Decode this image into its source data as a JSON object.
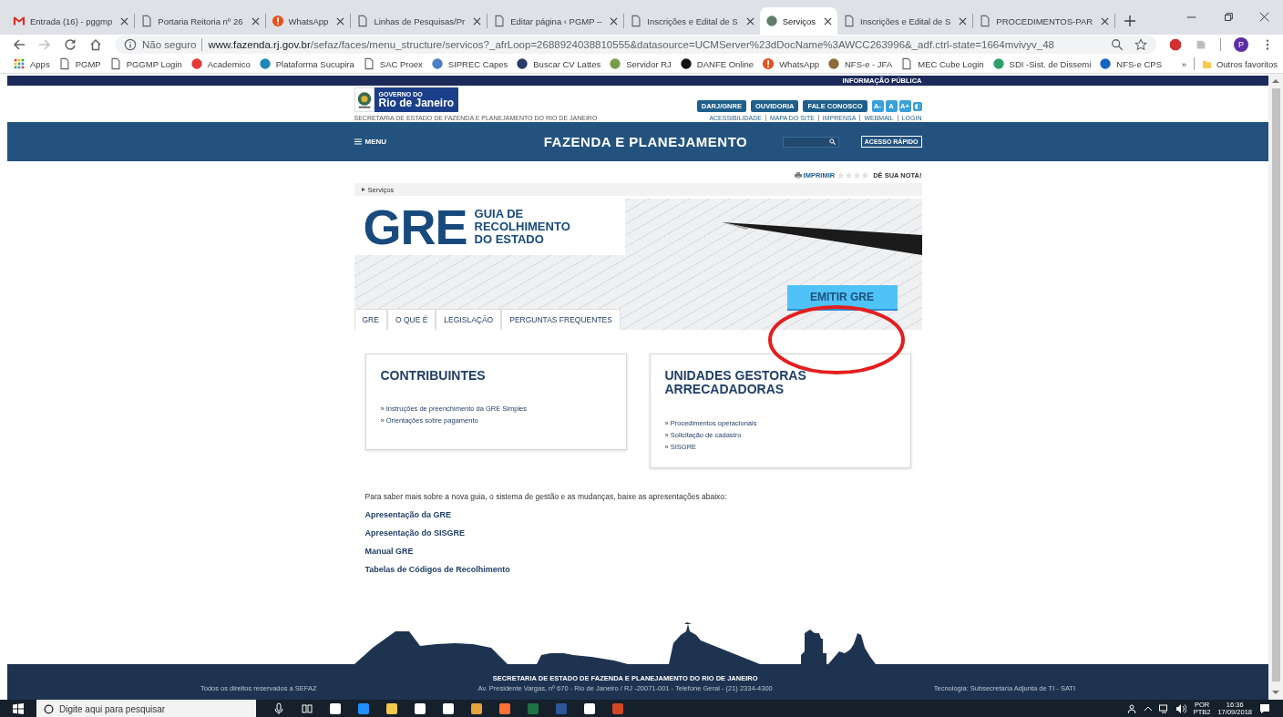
{
  "browser_tabs": [
    {
      "kind": "gmail",
      "title": "Entrada (16) - pggmp",
      "selected": false
    },
    {
      "kind": "page",
      "title": "Portaria Reitoria nº 26",
      "selected": false
    },
    {
      "kind": "alert",
      "title": "WhatsApp",
      "selected": false
    },
    {
      "kind": "page",
      "title": "Linhas de Pesquisas/Pr",
      "selected": false
    },
    {
      "kind": "page",
      "title": "Editar página ‹ PGMP –",
      "selected": false
    },
    {
      "kind": "page",
      "title": "Inscrições e Edital de S",
      "selected": false
    },
    {
      "kind": "logo",
      "color": "#5f7f6a",
      "title": "Serviços",
      "selected": true
    },
    {
      "kind": "page",
      "title": "Inscrições e Edital de S",
      "selected": false
    },
    {
      "kind": "page",
      "title": "PROCEDIMENTOS-PAR",
      "selected": false
    }
  ],
  "address_bar": {
    "security": "Não seguro",
    "host": "www.fazenda.rj.gov.br",
    "path": "/sefaz/faces/menu_structure/servicos?_afrLoop=2688924038810555&datasource=UCMServer%23dDocName%3AWCC263996&_adf.ctrl-state=1664mvivyv_48",
    "profile_initial": "P"
  },
  "bookmarks": [
    {
      "kind": "grid",
      "label": "Apps"
    },
    {
      "kind": "page",
      "label": "PGMP"
    },
    {
      "kind": "page",
      "label": "PGGMP Login"
    },
    {
      "kind": "logo",
      "color": "#e53935",
      "label": "Academico"
    },
    {
      "kind": "logo",
      "color": "#1e88b4",
      "label": "Plataforma Sucupira"
    },
    {
      "kind": "page",
      "label": "SAC Proex"
    },
    {
      "kind": "logo",
      "color": "#4a7fc1",
      "label": "SIPREC Capes"
    },
    {
      "kind": "logo",
      "color": "#2b3a67",
      "label": "Buscar CV Lattes"
    },
    {
      "kind": "logo",
      "color": "#7a9a4a",
      "label": "Servidor RJ"
    },
    {
      "kind": "logo",
      "color": "#111111",
      "label": "DANFE Online"
    },
    {
      "kind": "alert",
      "label": "WhatsApp"
    },
    {
      "kind": "logo",
      "color": "#8a6d3b",
      "label": "NFS-e - JFA"
    },
    {
      "kind": "page",
      "label": "MEC Cube Login"
    },
    {
      "kind": "logo",
      "color": "#2e9e6a",
      "label": "SDI -Sist. de Dissemi"
    },
    {
      "kind": "logo",
      "color": "#1565c0",
      "label": "NFS-e CPS"
    }
  ],
  "bookmarks_overflow": "»",
  "other_bookmarks": "Outros favoritos",
  "site": {
    "top_strip": "INFORMAÇÃO PÚBLICA",
    "logo_small": "GOVERNO DO",
    "logo_big": "Rio de Janeiro",
    "secretariat": "SECRETARIA DE ESTADO DE FAZENDA E PLANEJAMENTO DO RIO DE JANEIRO",
    "header_buttons": [
      "DARJ/GNRE",
      "OUVIDORIA",
      "FALE CONOSCO"
    ],
    "font_buttons": [
      "A-",
      "A",
      "A+"
    ],
    "utility_links": [
      "ACESSIBILIDADE",
      "MAPA DO SITE",
      "IMPRENSA",
      "WEBMAIL",
      "LOGIN"
    ],
    "menu": "MENU",
    "title": "FAZENDA E PLANEJAMENTO",
    "quick_access": "ACESSO RÁPIDO"
  },
  "print": "IMPRIMIR",
  "rating": {
    "stars": 0,
    "label": "DÊ SUA NOTA!"
  },
  "breadcrumb": "Serviços",
  "banner": {
    "acronym": "GRE",
    "subtitle_lines": [
      "GUIA DE",
      "RECOLHIMENTO",
      "DO ESTADO"
    ],
    "button": "EMITIR GRE",
    "tabs": [
      "GRE",
      "O QUE É",
      "LEGISLAÇÃO",
      "PERGUNTAS FREQUENTES"
    ]
  },
  "cards": [
    {
      "title": "CONTRIBUINTES",
      "links": [
        "» Instruções de preenchimento da GRE Simples",
        "» Orientações sobre pagamento"
      ]
    },
    {
      "title": "UNIDADES GESTORAS ARRECADADORAS",
      "links": [
        "» Procedimentos operacionais",
        "» Solicitação de cadastro",
        "» SISGRE"
      ]
    }
  ],
  "intro": "Para saber mais sobre a nova guia, o sistema de gestão e as mudanças, baixe as apresentações abaixo:",
  "downloads": [
    "Apresentação da GRE",
    "Apresentação do SISGRE",
    "Manual GRE",
    "Tabelas de Códigos de Recolhimento"
  ],
  "footer": {
    "left": "Todos os direitos reservados a SEFAZ",
    "center_title": "SECRETARIA DE ESTADO DE FAZENDA E PLANEJAMENTO DO RIO DE JANEIRO",
    "center_address": "Av. Presidente Vargas, nº 670 - Rio de Janeiro / RJ -20071-001 - Telefone Geral - (21) 2334-4300",
    "right": "Tecnologia: Subsecretaria Adjunta de TI - SATI"
  },
  "taskbar": {
    "search_placeholder": "Digite aqui para pesquisar",
    "language": "POR",
    "layout": "PTB2",
    "time": "16:36",
    "date": "17/09/2018"
  }
}
